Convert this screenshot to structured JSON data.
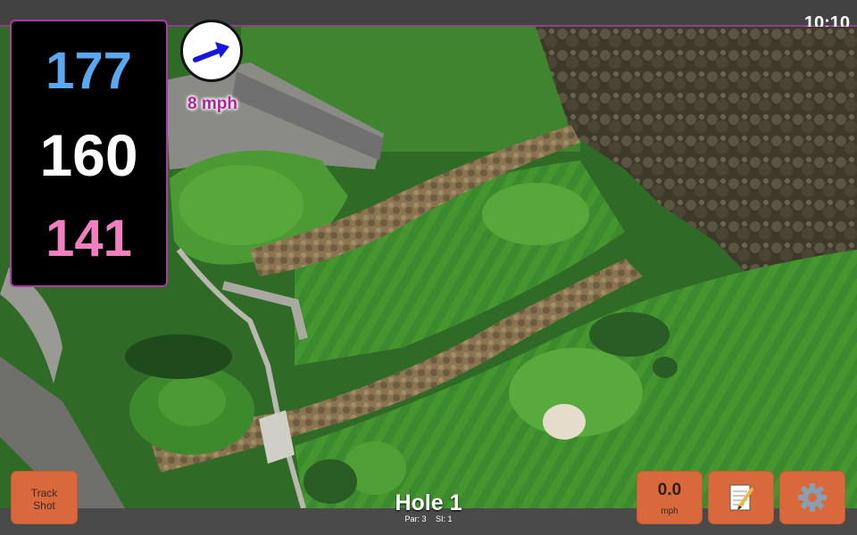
{
  "status_bar": {
    "time": "10:10"
  },
  "distances": {
    "back": "177",
    "center": "160",
    "front": "141"
  },
  "wind": {
    "speed_label": "8 mph",
    "direction_icon": "arrow-icon",
    "color": "#1616e0"
  },
  "buttons": {
    "track_shot_line1": "Track",
    "track_shot_line2": "Shot",
    "wind_value": "0.0",
    "wind_unit": "mph",
    "notes_icon": "notepad-icon",
    "settings_icon": "gear-icon"
  },
  "hole": {
    "title": "Hole 1",
    "par": "Par: 3",
    "si": "SI: 1"
  },
  "colors": {
    "accent": "#b03aa3",
    "button": "#d9683c",
    "back": "#5aa9f0",
    "front": "#f07fc0"
  }
}
